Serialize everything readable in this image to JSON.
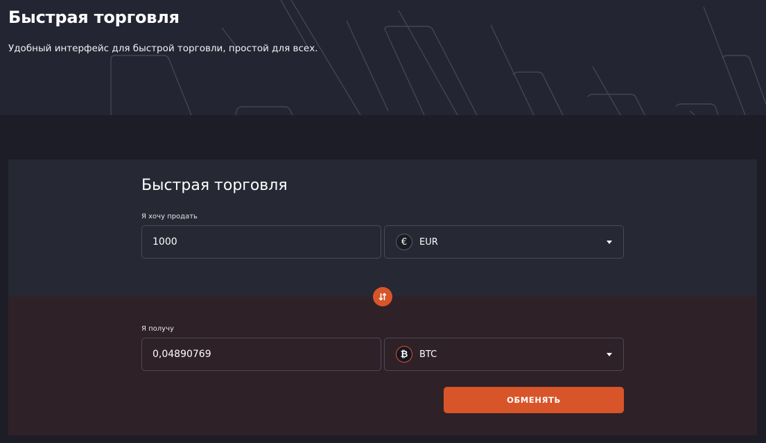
{
  "hero": {
    "title": "Быстрая торговля",
    "subtitle": "Удобный интерфейс для быстрой торговли, простой для всех."
  },
  "trade_form": {
    "title": "Быстрая торговля",
    "sell": {
      "label": "Я хочу продать",
      "amount": "1000",
      "currency": "EUR",
      "currency_icon": "euro-icon",
      "currency_symbol": "€"
    },
    "receive": {
      "label": "Я получу",
      "amount": "0,04890769",
      "currency": "BTC",
      "currency_icon": "bitcoin-icon",
      "currency_symbol": "₿"
    },
    "swap_icon": "swap-arrows-icon",
    "submit_label": "ОБМЕНЯТЬ"
  },
  "colors": {
    "accent": "#d8552a",
    "hero_background": "#232532",
    "page_background": "#1c1d27",
    "card_top": "#262833",
    "card_bottom": "#2f2128"
  }
}
